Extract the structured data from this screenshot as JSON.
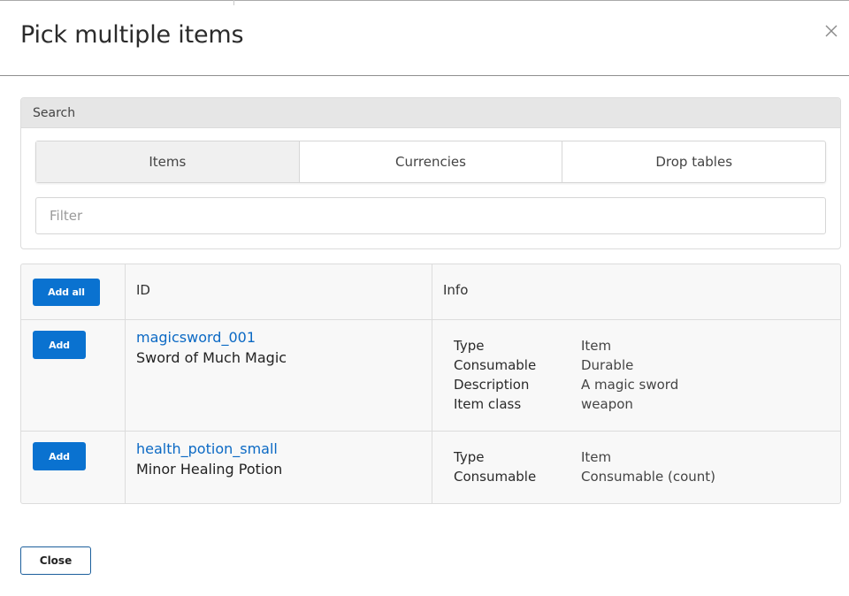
{
  "modal": {
    "title": "Pick multiple items",
    "close_icon": "close-icon"
  },
  "search": {
    "heading": "Search",
    "tabs": [
      {
        "label": "Items",
        "active": true
      },
      {
        "label": "Currencies",
        "active": false
      },
      {
        "label": "Drop tables",
        "active": false
      }
    ],
    "filter_placeholder": "Filter",
    "filter_value": ""
  },
  "table": {
    "add_all_label": "Add all",
    "columns": {
      "id": "ID",
      "info": "Info"
    },
    "rows": [
      {
        "add_label": "Add",
        "id": "magicsword_001",
        "name": "Sword of Much Magic",
        "info": [
          {
            "key": "Type",
            "value": "Item"
          },
          {
            "key": "Consumable",
            "value": "Durable"
          },
          {
            "key": "Description",
            "value": "A magic sword"
          },
          {
            "key": "Item class",
            "value": "weapon"
          }
        ]
      },
      {
        "add_label": "Add",
        "id": "health_potion_small",
        "name": "Minor Healing Potion",
        "info": [
          {
            "key": "Type",
            "value": "Item"
          },
          {
            "key": "Consumable",
            "value": "Consumable (count)"
          }
        ]
      }
    ]
  },
  "footer": {
    "close_label": "Close"
  },
  "colors": {
    "accent": "#0a72d0",
    "link": "#0b69c4",
    "panel_header": "#e6e6e6",
    "table_bg": "#f8f8f8"
  }
}
